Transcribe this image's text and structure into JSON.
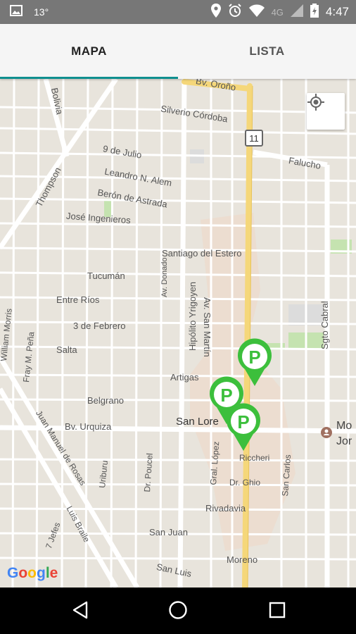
{
  "status_bar": {
    "temperature": "13°",
    "network": "4G",
    "time": "4:47"
  },
  "tabs": [
    {
      "label": "MAPA",
      "active": true
    },
    {
      "label": "LISTA",
      "active": false
    }
  ],
  "map": {
    "streets": {
      "bv_orono": "Bv. Oroño",
      "silverio_cordoba": "Silverio Córdoba",
      "bolivia": "Bolivia",
      "nueve_de_julio": "9 de Julio",
      "leandro_alem": "Leandro N. Alem",
      "beron_de_astrada": "Berón de Astrada",
      "jose_ingenieros": "José Ingenieros",
      "thompson": "Thompson",
      "falucho": "Falucho",
      "santiago_del_estero": "Santiago del Estero",
      "tucuman": "Tucumán",
      "entre_rios": "Entre Ríos",
      "tres_de_febrero": "3 de Febrero",
      "salta": "Salta",
      "artigas": "Artigas",
      "belgrano": "Belgrano",
      "bv_urquiza": "Bv. Urquiza",
      "san_lorenzo": "San Lore",
      "av_san_martin": "Av. San Martín",
      "av_donado": "Av. Donado",
      "hipolito_yrigoyen": "Hipólito Yrigoyen",
      "sgto_cabral": "Sgto Cabral",
      "william_morris": "William Morris",
      "fray_peria": "Fray M. Peña",
      "juan_manuel_de_rosas": "Juan Manuel de Rosas",
      "uriburu": "Uriburu",
      "dr_poucel": "Dr. Poucel",
      "san_carlos": "San Carlos",
      "riccheri": "Riccheri",
      "dr_ghio": "Dr. Ghio",
      "gral_lopez": "Gral. López",
      "rivadavia": "Rivadavia",
      "san_juan": "San Juan",
      "moreno": "Moreno",
      "san_luis": "San Luis",
      "siete_jefes": "7 Jefes",
      "luis_braile": "Luis Braile"
    },
    "route_shield": "11",
    "poi_label_line1": "Mo",
    "poi_label_line2": "Jor",
    "parking_marker_label": "P",
    "attribution": "Google"
  },
  "colors": {
    "tab_indicator": "#0f8f8f",
    "parking_green": "#3cbf3c",
    "main_road": "#f5d77a",
    "map_bg": "#e8e4dc",
    "park": "#c5e3b0"
  }
}
